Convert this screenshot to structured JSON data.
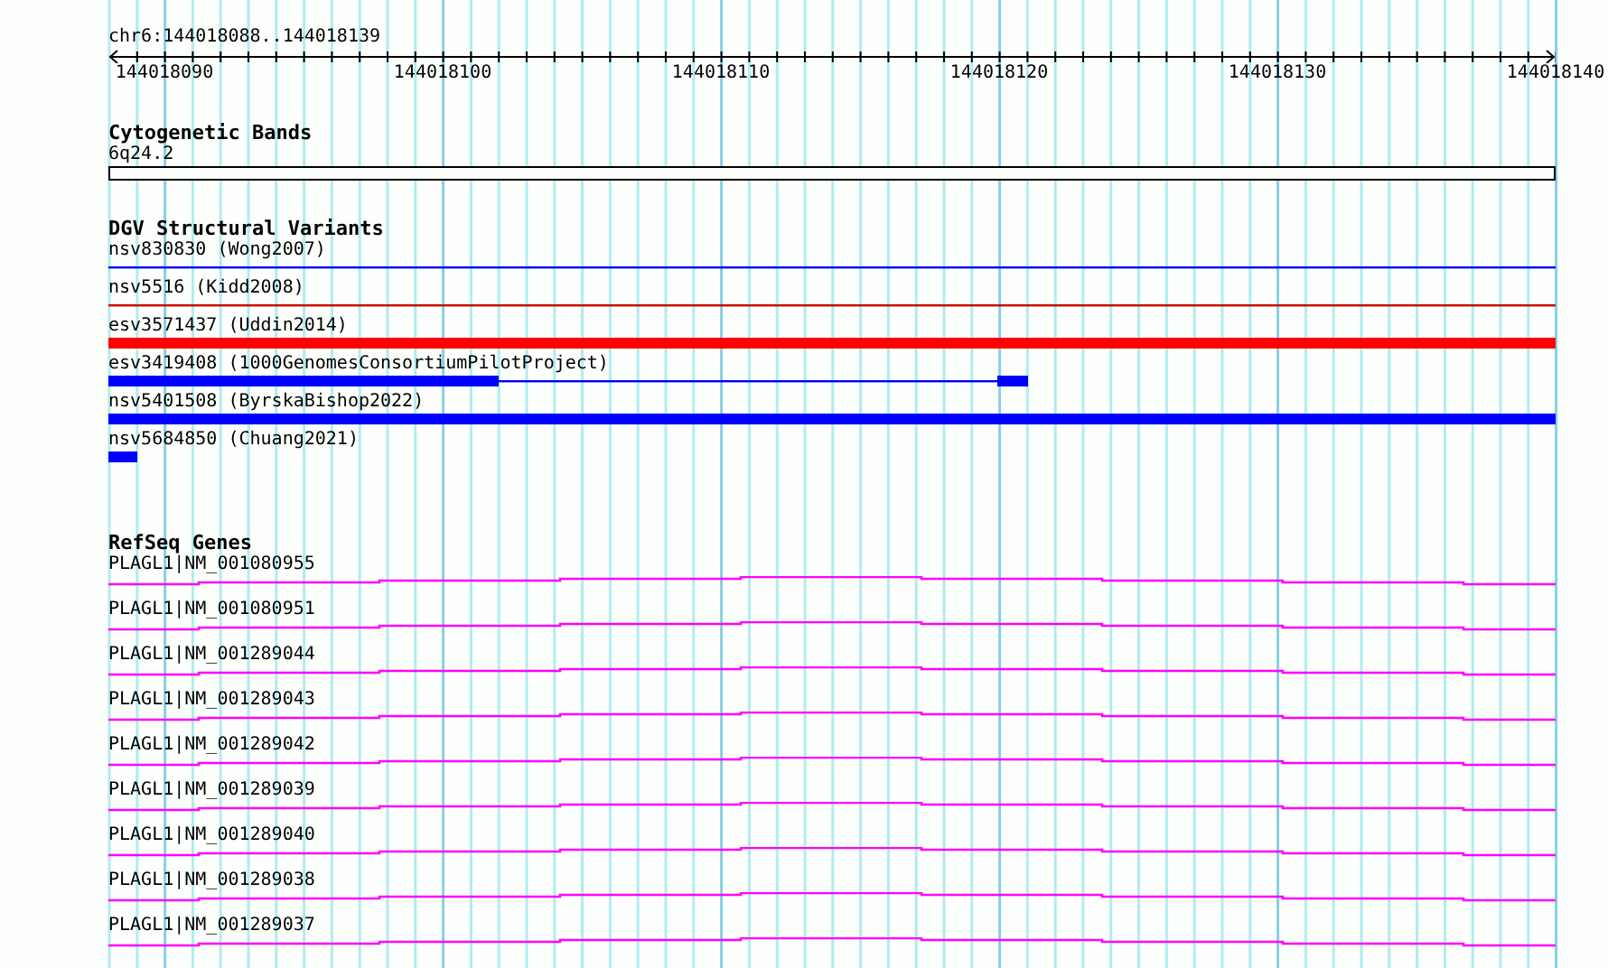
{
  "ruler": {
    "location": "chr6:144018088..144018139",
    "ticks": [
      "144018090",
      "144018100",
      "144018110",
      "144018120",
      "144018130",
      "144018140"
    ]
  },
  "cytogenetic_bands": {
    "title": "Cytogenetic Bands",
    "band": "6q24.2"
  },
  "dgv_structural_variants": {
    "title": "DGV Structural Variants",
    "features": [
      {
        "label": "nsv830830 (Wong2007)",
        "color": "#0000ff",
        "kind": "line"
      },
      {
        "label": "nsv5516 (Kidd2008)",
        "color": "#cc0000",
        "kind": "line"
      },
      {
        "label": "esv3571437 (Uddin2014)",
        "color": "#ff0000",
        "kind": "bar"
      },
      {
        "label": "esv3419408 (1000GenomesConsortiumPilotProject)",
        "color": "#0000ff",
        "kind": "gapped"
      },
      {
        "label": "nsv5401508 (ByrskaBishop2022)",
        "color": "#0000ff",
        "kind": "bar"
      },
      {
        "label": "nsv5684850 (Chuang2021)",
        "color": "#0000ff",
        "kind": "short"
      }
    ]
  },
  "refseq_genes": {
    "title": "RefSeq Genes",
    "genes": [
      {
        "label": "PLAGL1|NM_001080955"
      },
      {
        "label": "PLAGL1|NM_001080951"
      },
      {
        "label": "PLAGL1|NM_001289044"
      },
      {
        "label": "PLAGL1|NM_001289043"
      },
      {
        "label": "PLAGL1|NM_001289042"
      },
      {
        "label": "PLAGL1|NM_001289039"
      },
      {
        "label": "PLAGL1|NM_001289040"
      },
      {
        "label": "PLAGL1|NM_001289038"
      },
      {
        "label": "PLAGL1|NM_001289037"
      }
    ]
  }
}
